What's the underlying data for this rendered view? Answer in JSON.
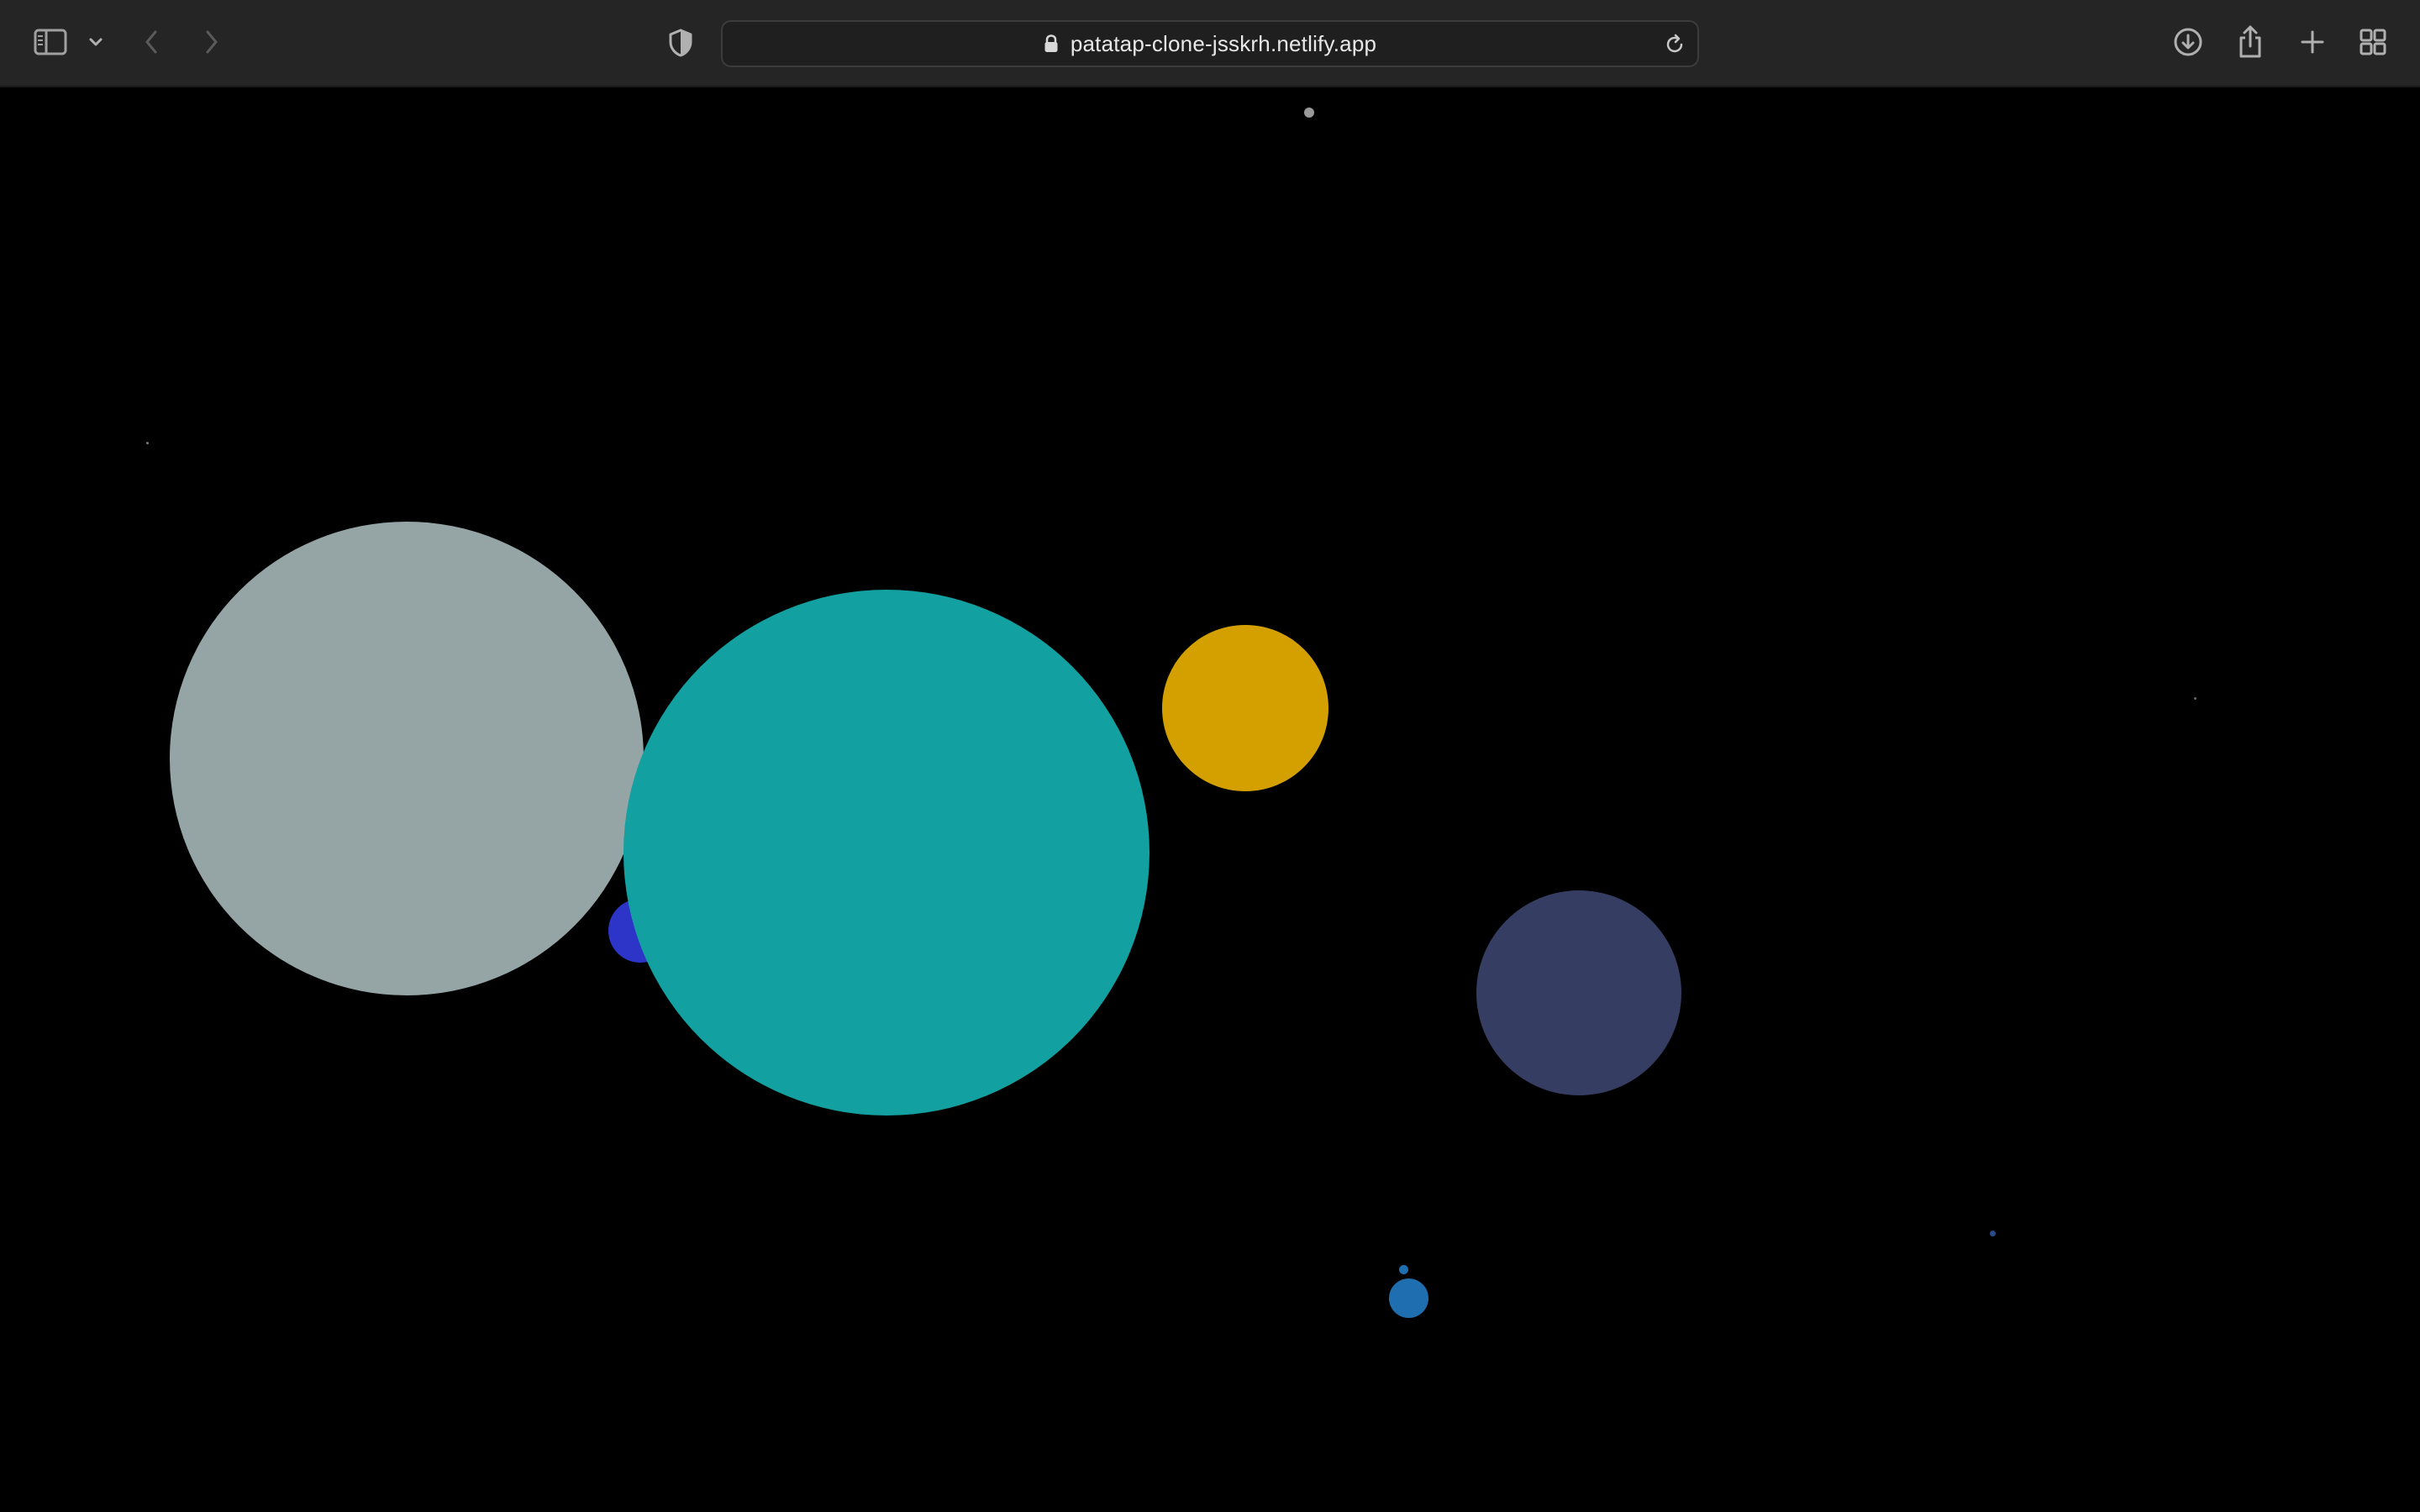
{
  "browser": {
    "url": "patatap-clone-jsskrh.netlify.app",
    "icons": {
      "sidebar": "sidebar-toggle-icon",
      "tab_group_menu": "chevron-down-icon",
      "back": "chevron-left-icon",
      "forward": "chevron-right-icon",
      "privacy": "shield-icon",
      "lock": "lock-icon",
      "reload": "reload-icon",
      "downloads": "download-icon",
      "share": "share-icon",
      "new_tab": "plus-icon",
      "tab_overview": "grid-icon"
    }
  },
  "canvas": {
    "background": "#000000",
    "bubble_colors": {
      "gray": "#95a5a6",
      "teal": "#16a085",
      "teal_render": "#13a0a0",
      "gold": "#d4a000",
      "navy": "#363d62",
      "blue": "#2d35c8",
      "steel_blue": "#1f6fb0",
      "small_gray": "#9a9a9a",
      "dot_blue": "#2b4a8a"
    }
  }
}
